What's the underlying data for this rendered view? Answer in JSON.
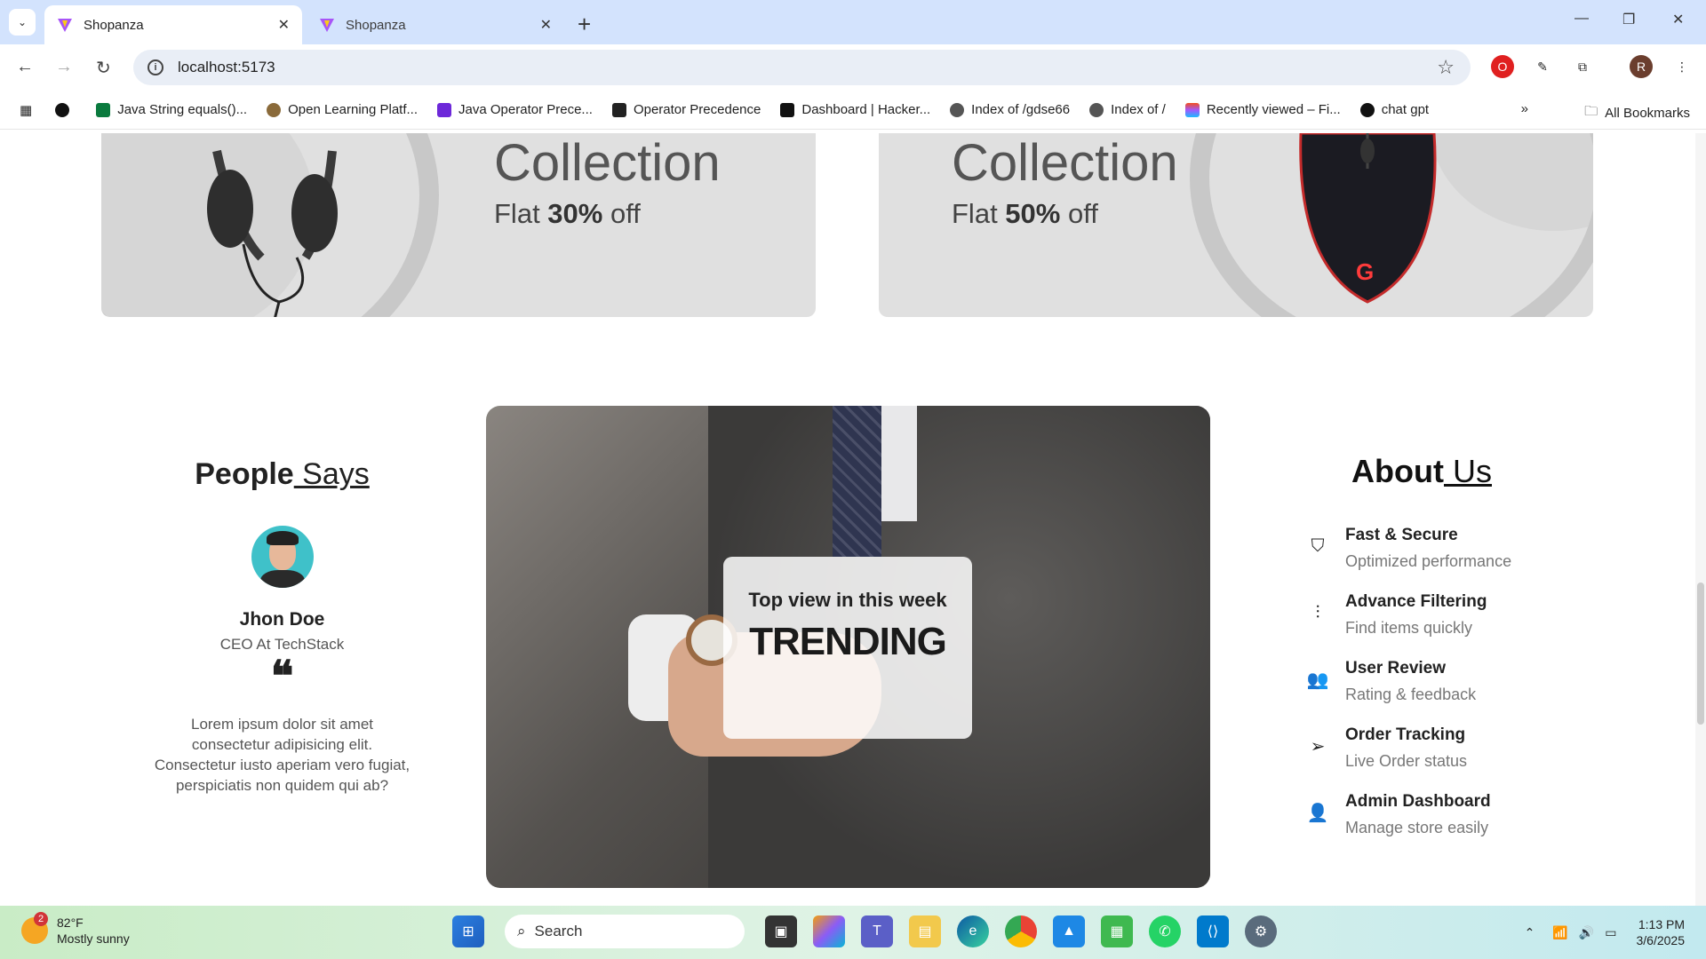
{
  "browser": {
    "tabs": [
      {
        "title": "Shopanza",
        "active": true
      },
      {
        "title": "Shopanza",
        "active": false
      }
    ],
    "url": "localhost:5173",
    "profile_initial": "R",
    "bookmarks": [
      {
        "label": "",
        "icon": "github-icon"
      },
      {
        "label": "Java String equals()...",
        "icon": "w-icon"
      },
      {
        "label": "Open Learning Platf...",
        "icon": "owl-icon"
      },
      {
        "label": "Java Operator Prece...",
        "icon": "p-icon"
      },
      {
        "label": "Operator Precedence",
        "icon": "shield-icon"
      },
      {
        "label": "Dashboard | Hacker...",
        "icon": "h-icon"
      },
      {
        "label": "Index of /gdse66",
        "icon": "globe-icon"
      },
      {
        "label": "Index of /",
        "icon": "globe-icon"
      },
      {
        "label": "Recently viewed – Fi...",
        "icon": "figma-icon"
      },
      {
        "label": "chat gpt",
        "icon": "openai-icon"
      }
    ],
    "all_bookmarks": "All Bookmarks"
  },
  "banners": [
    {
      "heading": "Collection",
      "flat_prefix": "Flat ",
      "discount": "30%",
      "flat_suffix": " off",
      "product": "headphones"
    },
    {
      "heading": "Collection",
      "flat_prefix": "Flat ",
      "discount": "50%",
      "flat_suffix": " off",
      "product": "mouse"
    }
  ],
  "people": {
    "title_bold": "People",
    "title_underline": " Says",
    "name": "Jhon Doe",
    "role": "CEO At TechStack",
    "quote_mark": "❝",
    "text": "Lorem ipsum dolor sit amet consectetur adipisicing elit. Consectetur iusto aperiam vero fugiat, perspiciatis non quidem qui ab?"
  },
  "hero": {
    "subtitle": "Top view in this week",
    "title": "TRENDING"
  },
  "about": {
    "title_bold": "About",
    "title_underline": " Us",
    "features": [
      {
        "title": "Fast & Secure",
        "subtitle": "Optimized performance",
        "icon": "shield-check-icon"
      },
      {
        "title": "Advance Filtering",
        "subtitle": "Find items quickly",
        "icon": "sliders-icon"
      },
      {
        "title": "User Review",
        "subtitle": "Rating & feedback",
        "icon": "users-icon"
      },
      {
        "title": "Order Tracking",
        "subtitle": "Live Order status",
        "icon": "send-icon"
      },
      {
        "title": "Admin Dashboard",
        "subtitle": "Manage store easily",
        "icon": "admin-icon"
      }
    ]
  },
  "taskbar": {
    "weather_temp": "82°F",
    "weather_desc": "Mostly sunny",
    "weather_badge": "2",
    "search_label": "Search",
    "time": "1:13 PM",
    "date": "3/6/2025"
  }
}
